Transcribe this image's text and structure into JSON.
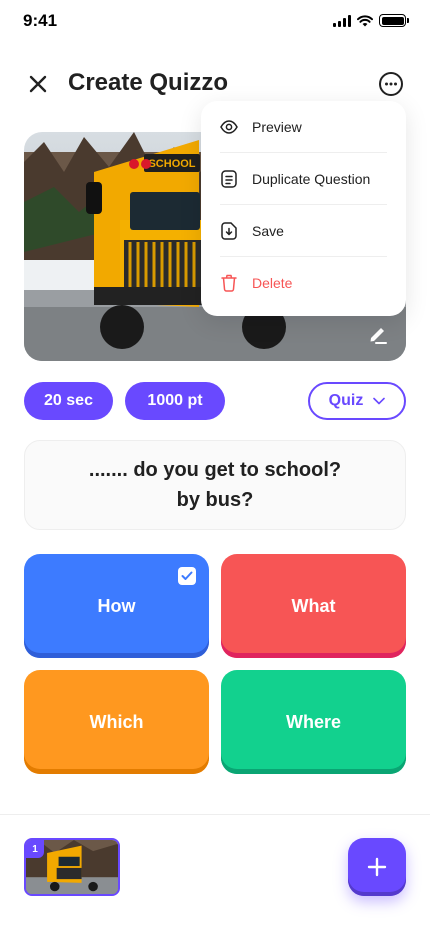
{
  "status_bar": {
    "time": "9:41"
  },
  "header": {
    "title": "Create Quizzo"
  },
  "settings": {
    "time_limit": "20 sec",
    "points": "1000 pt",
    "type": "Quiz"
  },
  "question": {
    "line1": "....... do you get to school?",
    "line2": "by bus?"
  },
  "answers": [
    {
      "label": "How",
      "color": "#3D7BFF",
      "correct": true
    },
    {
      "label": "What",
      "color": "#F75555",
      "correct": false
    },
    {
      "label": "Which",
      "color": "#FF981F",
      "correct": false
    },
    {
      "label": "Where",
      "color": "#12D18E",
      "correct": false
    }
  ],
  "menu": {
    "items": [
      {
        "label": "Preview",
        "icon": "eye-icon"
      },
      {
        "label": "Duplicate Question",
        "icon": "document-icon"
      },
      {
        "label": "Save",
        "icon": "save-icon"
      },
      {
        "label": "Delete",
        "icon": "trash-icon",
        "danger": true
      }
    ]
  },
  "cover": {
    "sign_text": "SCHOOL"
  },
  "slides": [
    {
      "number": "1",
      "active": true
    }
  ],
  "colors": {
    "primary": "#6949FF",
    "danger": "#F75555",
    "text": "#212121"
  }
}
